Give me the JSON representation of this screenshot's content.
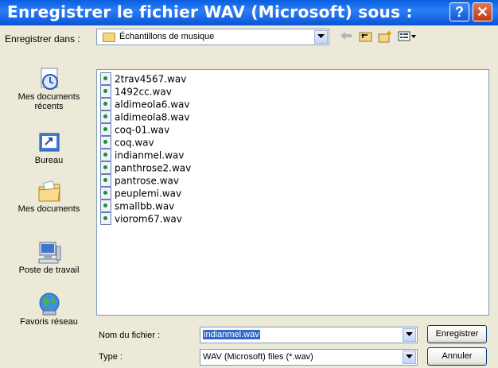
{
  "window": {
    "title": "Enregistrer le fichier WAV (Microsoft) sous :",
    "help_glyph": "?",
    "close_glyph": "✕"
  },
  "save_in": {
    "label": "Enregistrer dans :",
    "value": "Échantillons de musique"
  },
  "toolbar": {
    "back_icon": "back-arrow-icon",
    "up_icon": "up-folder-icon",
    "new_folder_icon": "new-folder-icon",
    "view_icon": "view-menu-icon"
  },
  "places": [
    {
      "label": "Mes documents récents",
      "icon": "recent-documents-icon"
    },
    {
      "label": "Bureau",
      "icon": "desktop-icon"
    },
    {
      "label": "Mes documents",
      "icon": "my-documents-icon"
    },
    {
      "label": "Poste de travail",
      "icon": "my-computer-icon"
    },
    {
      "label": "Favoris réseau",
      "icon": "network-places-icon"
    }
  ],
  "files": [
    "2trav4567.wav",
    "1492cc.wav",
    "aldimeola6.wav",
    "aldimeola8.wav",
    "coq-01.wav",
    "coq.wav",
    "indianmel.wav",
    "panthrose2.wav",
    "pantrose.wav",
    "peuplemi.wav",
    "smallbb.wav",
    "viorom67.wav"
  ],
  "filename": {
    "label": "Nom du fichier :",
    "value": "indianmel.wav"
  },
  "filetype": {
    "label": "Type :",
    "value": "WAV (Microsoft) files (*.wav)"
  },
  "buttons": {
    "save": "Enregistrer",
    "cancel": "Annuler"
  },
  "colors": {
    "titlebar": "#0A5FE0",
    "dialog_bg": "#ECE9D8",
    "selection": "#316AC5"
  }
}
